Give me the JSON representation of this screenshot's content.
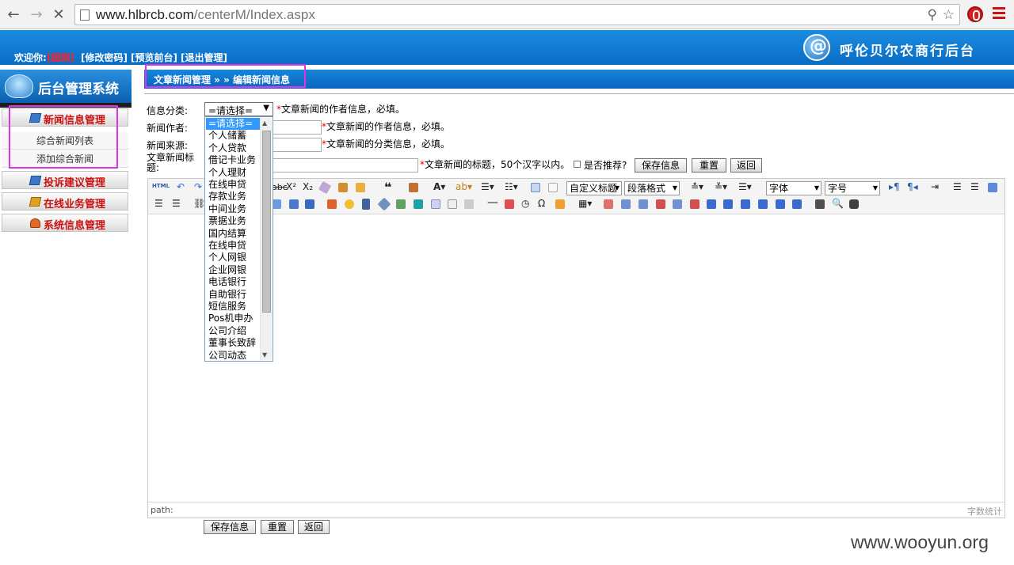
{
  "browser": {
    "url_host": "www.hlbrcb.com",
    "url_path": "/centerM/Index.aspx",
    "colors": {
      "extension_icon": "#d61f1f",
      "menu_icon": "#cc1111"
    }
  },
  "header": {
    "welcome": "欢迎你:",
    "username": "[超刚]",
    "links": [
      "[修改密码]",
      "[预览前台]",
      "[退出管理]"
    ],
    "brand_name": "呼伦贝尔农商行后台",
    "brand_icon": "at-globe-icon",
    "colors": {
      "bar": "#0a6cc5",
      "username": "#ff2222"
    }
  },
  "sidebar": {
    "logo_text": "后台管理系统",
    "menus": [
      {
        "label": "新闻信息管理",
        "icon": "news-icon",
        "items": [
          "综合新闻列表",
          "添加综合新闻"
        ]
      },
      {
        "label": "投诉建议管理",
        "icon": "complaint-icon",
        "items": []
      },
      {
        "label": "在线业务管理",
        "icon": "business-icon",
        "items": []
      },
      {
        "label": "系统信息管理",
        "icon": "user-icon",
        "items": []
      }
    ]
  },
  "breadcrumb": "文章新闻管理 » » 编辑新闻信息",
  "form": {
    "category": {
      "label": "信息分类:",
      "selected": "=请选择=",
      "hint": "文章新闻的作者信息，必填。",
      "options": [
        "=请选择=",
        "个人储蓄",
        "个人贷款",
        "借记卡业务",
        "个人理财",
        "在线申贷",
        "存款业务",
        "中间业务",
        "票据业务",
        "国内结算",
        "在线申贷",
        "个人网银",
        "企业网银",
        "电话银行",
        "自助银行",
        "短信服务",
        "Pos机申办",
        "公司介绍",
        "董事长致辞",
        "公司动态"
      ]
    },
    "author": {
      "label": "新闻作者:",
      "value": "",
      "hint": "文章新闻的作者信息，必填。"
    },
    "source": {
      "label": "新闻来源:",
      "value": "",
      "hint": "文章新闻的分类信息，必填。"
    },
    "title": {
      "label": "文章新闻标题:",
      "value": "",
      "hint": "文章新闻的标题，50个汉字以内。",
      "recommend_label": "是否推荐?",
      "recommend_checked": false
    },
    "required_mark": "*",
    "buttons": {
      "save": "保存信息",
      "reset": "重置",
      "back": "返回"
    }
  },
  "editor": {
    "html_label": "HTML",
    "combos": {
      "custom_heading": "自定义标题",
      "paragraph": "段落格式",
      "font": "字体",
      "font_size": "字号"
    },
    "status_path": "path:",
    "word_count": "字数统计",
    "colors": {
      "toolbar": "#f4f4f4"
    }
  },
  "watermark": "www.wooyun.org"
}
